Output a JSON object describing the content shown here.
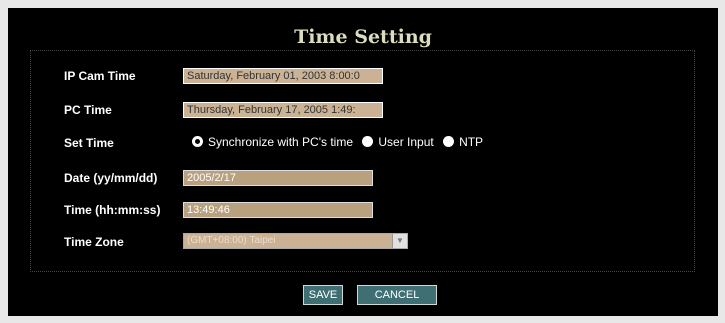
{
  "title": "Time Setting",
  "rows": {
    "ipcam_time": {
      "label": "IP Cam Time",
      "value": "Saturday, February 01, 2003 8:00:0"
    },
    "pc_time": {
      "label": "PC Time",
      "value": "Thursday, February 17, 2005 1:49:"
    },
    "set_time": {
      "label": "Set Time",
      "options": [
        "Synchronize with PC's time",
        "User Input",
        "NTP"
      ],
      "selected": "Synchronize with PC's time"
    },
    "date": {
      "label": "Date (yy/mm/dd)",
      "value": "2005/2/17"
    },
    "time": {
      "label": "Time (hh:mm:ss)",
      "value": "13:49:46"
    },
    "time_zone": {
      "label": "Time Zone",
      "value": "(GMT+08:00) Taipei"
    }
  },
  "buttons": {
    "save": "SAVE",
    "cancel": "CANCEL"
  },
  "colors": {
    "background": "#000000",
    "field": "#ccb294",
    "button": "#3f6f73",
    "title": "#dcdcbe"
  }
}
